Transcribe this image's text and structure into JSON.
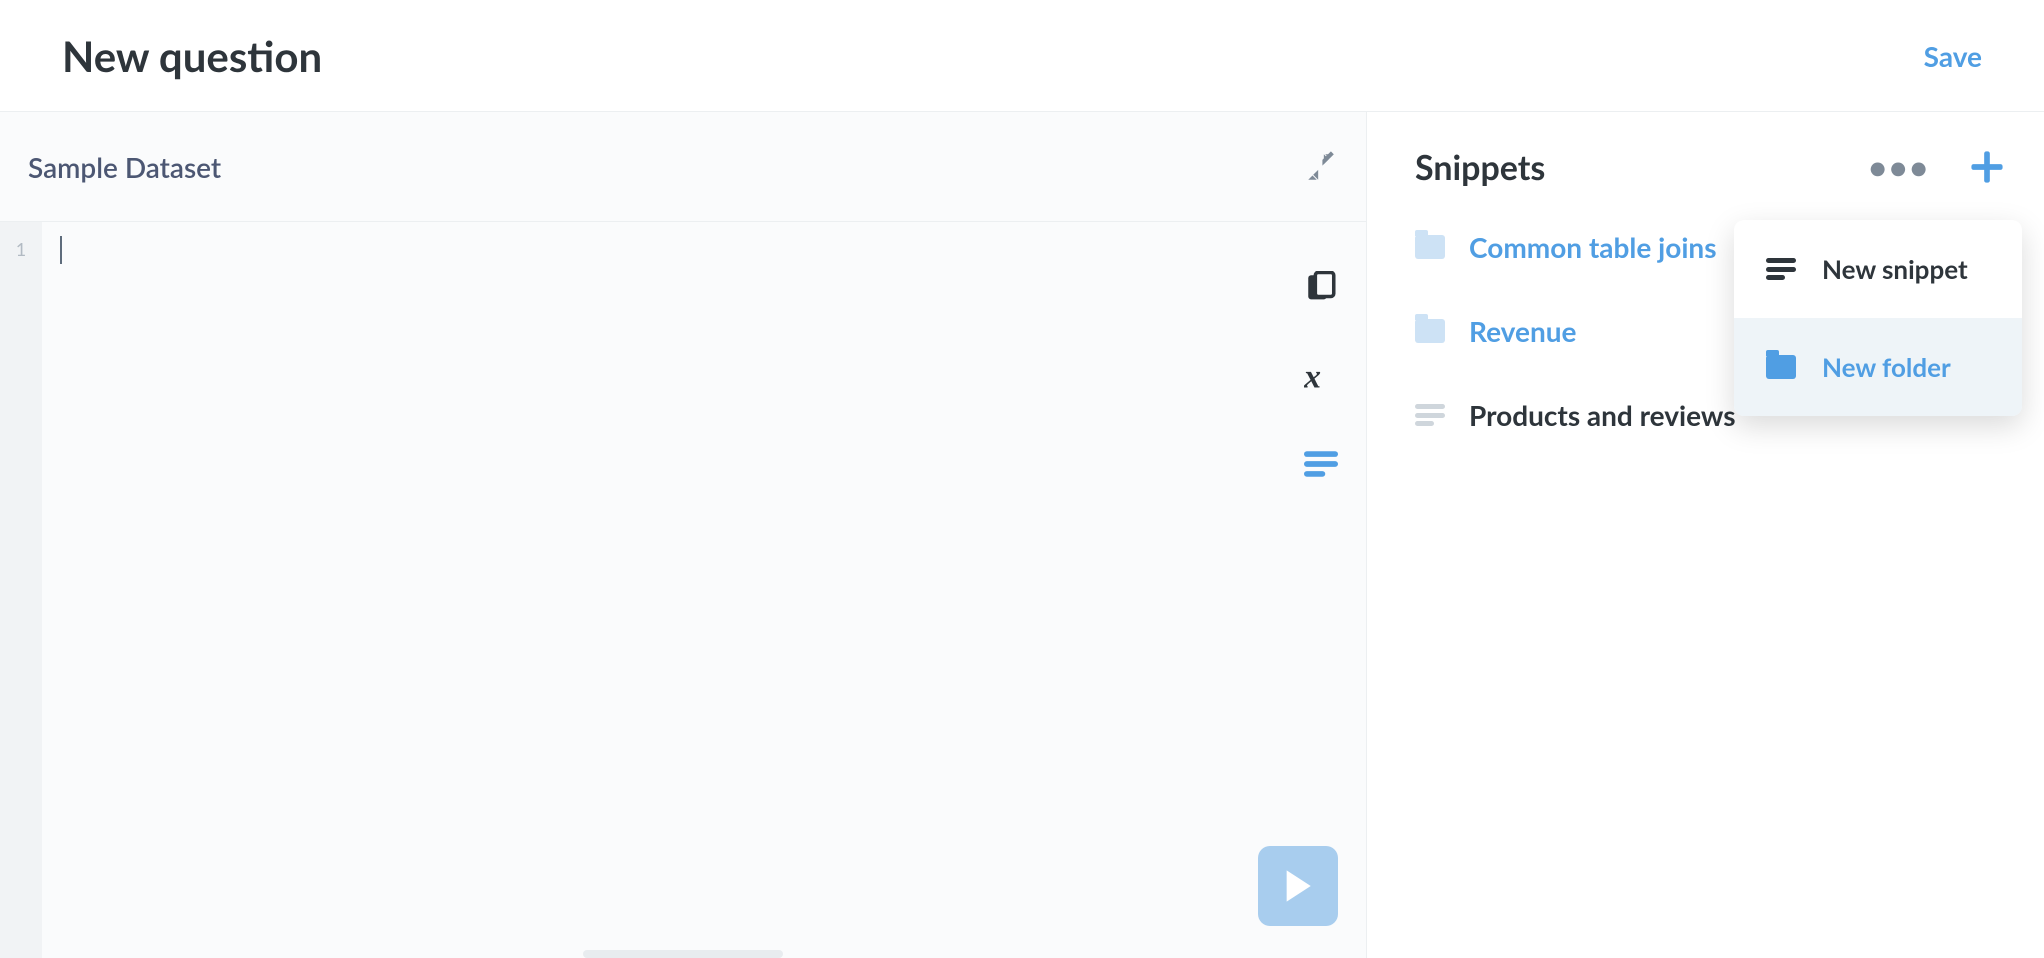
{
  "header": {
    "title": "New question",
    "save": "Save"
  },
  "editor": {
    "dataset": "Sample Dataset",
    "line_number": "1"
  },
  "snippets": {
    "title": "Snippets",
    "items": [
      {
        "type": "folder",
        "label": "Common table joins"
      },
      {
        "type": "folder",
        "label": "Revenue"
      },
      {
        "type": "snippet",
        "label": "Products and reviews"
      }
    ]
  },
  "popover": {
    "new_snippet": "New snippet",
    "new_folder": "New folder"
  }
}
